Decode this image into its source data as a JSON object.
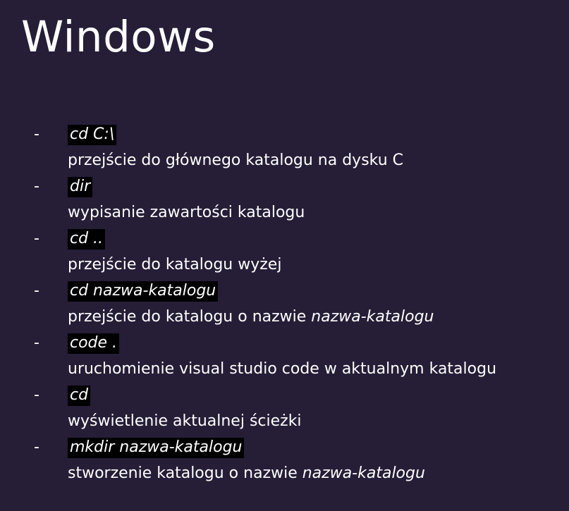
{
  "title": "Windows",
  "bullet": "-",
  "items": [
    {
      "command": "cd C:\\",
      "description": "przejście do głównego katalogu na dysku C",
      "emphasis": ""
    },
    {
      "command": "dir",
      "description": "wypisanie zawartości katalogu",
      "emphasis": ""
    },
    {
      "command": "cd ..",
      "description": "przejście do katalogu wyżej",
      "emphasis": ""
    },
    {
      "command": "cd nazwa-katalogu",
      "description": "przejście do katalogu o nazwie ",
      "emphasis": "nazwa-katalogu"
    },
    {
      "command": "code .",
      "description": "uruchomienie visual studio code w aktualnym katalogu",
      "emphasis": ""
    },
    {
      "command": "cd",
      "description": "wyświetlenie aktualnej ścieżki",
      "emphasis": ""
    },
    {
      "command": "mkdir nazwa-katalogu",
      "description": "stworzenie katalogu o nazwie ",
      "emphasis": "nazwa-katalogu"
    }
  ]
}
